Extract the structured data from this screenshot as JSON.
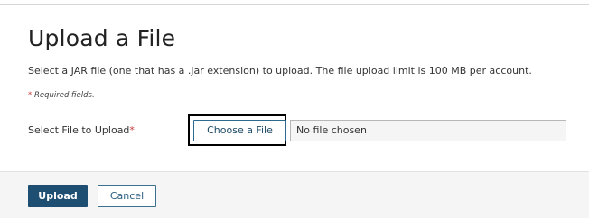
{
  "dialog": {
    "title": "Upload a File",
    "description": "Select a JAR file (one that has a .jar extension) to upload. The file upload limit is 100 MB per account.",
    "required_marker": "*",
    "required_text": "Required fields."
  },
  "file_field": {
    "label": "Select File to Upload",
    "required_marker": "*",
    "choose_button_label": "Choose a File",
    "file_status": "No file chosen"
  },
  "footer": {
    "upload_label": "Upload",
    "cancel_label": "Cancel"
  },
  "colors": {
    "primary_button": "#1e4f73",
    "button_outline": "#2c6b8f",
    "required_asterisk": "#c73a3a",
    "footer_background": "#f5f5f5",
    "focus_outline": "#000000"
  }
}
